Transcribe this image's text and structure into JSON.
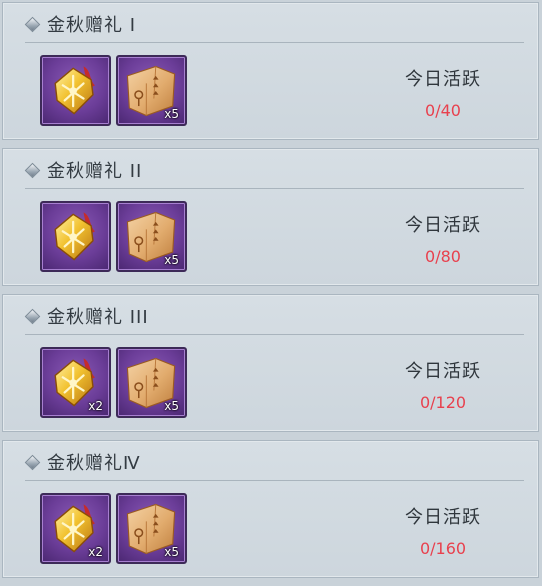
{
  "colors": {
    "panel_background": "#d1d9df",
    "progress_text": "#e8414e",
    "slot_purple": "#6b3d98"
  },
  "activity_label": "今日活跃",
  "tiers": [
    {
      "title": "金秋赠礼 I",
      "progress": "0/40",
      "rewards": [
        {
          "icon": "golden-badge-icon",
          "count": ""
        },
        {
          "icon": "treasure-map-scroll-icon",
          "count": "x5"
        }
      ]
    },
    {
      "title": "金秋赠礼 II",
      "progress": "0/80",
      "rewards": [
        {
          "icon": "golden-badge-icon",
          "count": ""
        },
        {
          "icon": "treasure-map-scroll-icon",
          "count": "x5"
        }
      ]
    },
    {
      "title": "金秋赠礼 III",
      "progress": "0/120",
      "rewards": [
        {
          "icon": "golden-badge-icon",
          "count": "x2"
        },
        {
          "icon": "treasure-map-scroll-icon",
          "count": "x5"
        }
      ]
    },
    {
      "title": "金秋赠礼Ⅳ",
      "progress": "0/160",
      "rewards": [
        {
          "icon": "golden-badge-icon",
          "count": "x2"
        },
        {
          "icon": "treasure-map-scroll-icon",
          "count": "x5"
        }
      ]
    }
  ]
}
